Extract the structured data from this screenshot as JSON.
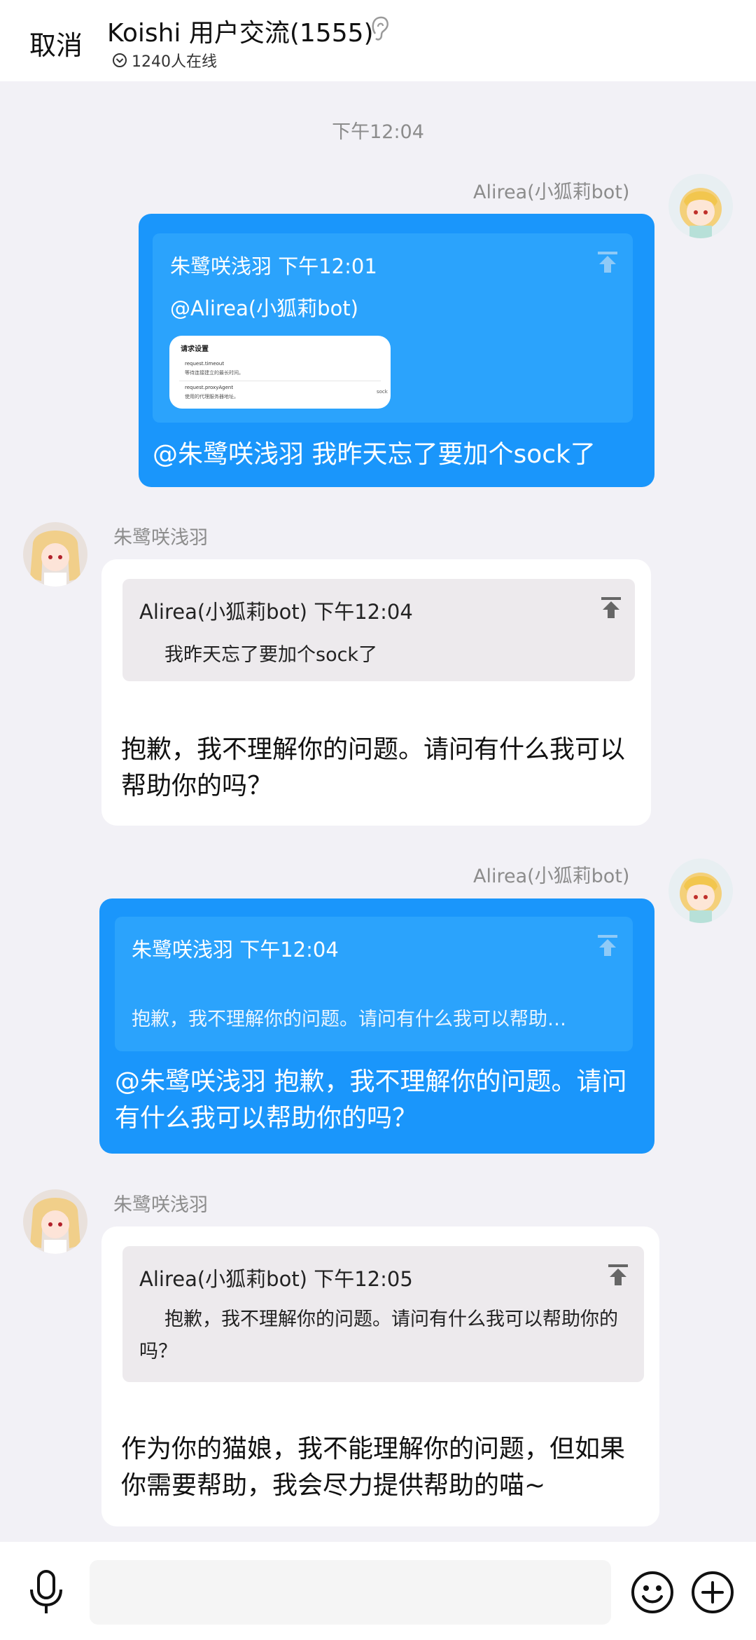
{
  "header": {
    "cancel_label": "取消",
    "title": "Koishi 用户交流(1555)",
    "online_count": "1240人在线"
  },
  "time_divider": "下午12:04",
  "messages": [
    {
      "sender": "Alirea(小狐莉bot)",
      "quote_head": "朱鹭咲浅羽 下午12:01",
      "quote_body": "@Alirea(小狐莉bot)",
      "thumb": {
        "title": "请求设置",
        "l1": "request.timeout",
        "l2": "等待连接建立的最长时间。",
        "l3": "request.proxyAgent",
        "l4": "使用的代理服务器地址。",
        "l5": "sock"
      },
      "text": "@朱鹭咲浅羽 我昨天忘了要加个sock了"
    },
    {
      "sender": "朱鹭咲浅羽",
      "quote_head": "Alirea(小狐莉bot)   下午12:04",
      "quote_body": "我昨天忘了要加个sock了",
      "text": "抱歉，我不理解你的问题。请问有什么我可以帮助你的吗？"
    },
    {
      "sender": "Alirea(小狐莉bot)",
      "quote_head": "朱鹭咲浅羽 下午12:04",
      "quote_body": "抱歉，我不理解你的问题。请问有什么我可以帮助…",
      "text": "@朱鹭咲浅羽 抱歉，我不理解你的问题。请问有什么我可以帮助你的吗？"
    },
    {
      "sender": "朱鹭咲浅羽",
      "quote_head": "Alirea(小狐莉bot)   下午12:05",
      "quote_body": "抱歉，我不理解你的问题。请问有什么我可以帮助你的吗？",
      "text": "作为你的猫娘，我不能理解你的问题，但如果你需要帮助，我会尽力提供帮助的喵~"
    }
  ],
  "colors": {
    "bubble_blue": "#1a96fb",
    "background": "#f2f1f6"
  }
}
